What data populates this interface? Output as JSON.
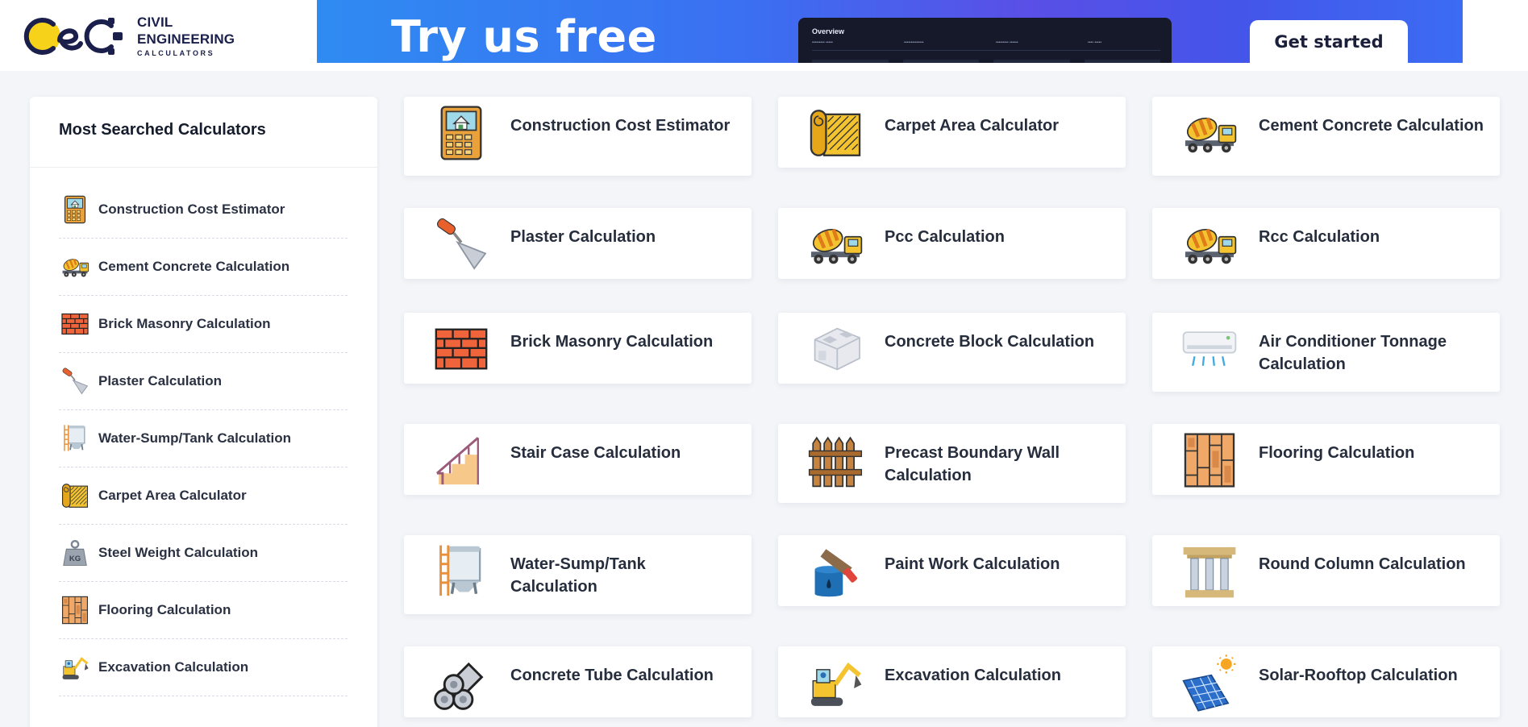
{
  "header": {
    "logo": {
      "line1": "CIVIL",
      "line2": "ENGINEERING",
      "line3": "CALCULATORS"
    },
    "banner": {
      "headline": "Try us free",
      "panel_title": "Overview",
      "panel_columns": [
        "••••••••• •••••",
        "••••••••••••••",
        "••••••••• ••••••",
        "•••• •••••"
      ],
      "cta_label": "Get started"
    }
  },
  "sidebar": {
    "title": "Most Searched Calculators",
    "items": [
      {
        "label": "Construction Cost Estimator",
        "icon": "calculator-house-icon"
      },
      {
        "label": "Cement Concrete Calculation",
        "icon": "concrete-mixer-truck-icon"
      },
      {
        "label": "Brick Masonry Calculation",
        "icon": "brick-wall-icon"
      },
      {
        "label": "Plaster Calculation",
        "icon": "plaster-trowel-icon"
      },
      {
        "label": "Water-Sump/Tank Calculation",
        "icon": "water-tank-icon"
      },
      {
        "label": "Carpet Area Calculator",
        "icon": "carpet-roll-icon"
      },
      {
        "label": "Steel Weight Calculation",
        "icon": "kg-weight-icon"
      },
      {
        "label": "Flooring Calculation",
        "icon": "wood-flooring-icon"
      },
      {
        "label": "Excavation Calculation",
        "icon": "excavator-icon"
      }
    ]
  },
  "cards": [
    {
      "label": "Construction Cost Estimator",
      "icon": "calculator-house-icon"
    },
    {
      "label": "Carpet Area Calculator",
      "icon": "carpet-roll-icon"
    },
    {
      "label": "Cement Concrete Calculation",
      "icon": "concrete-mixer-truck-icon"
    },
    {
      "label": "Plaster Calculation",
      "icon": "plaster-trowel-icon"
    },
    {
      "label": "Pcc Calculation",
      "icon": "concrete-mixer-truck-icon"
    },
    {
      "label": "Rcc Calculation",
      "icon": "concrete-mixer-truck-icon"
    },
    {
      "label": "Brick Masonry Calculation",
      "icon": "brick-wall-icon"
    },
    {
      "label": "Concrete Block Calculation",
      "icon": "concrete-block-icon"
    },
    {
      "label": "Air Conditioner Tonnage Calculation",
      "icon": "air-conditioner-icon"
    },
    {
      "label": "Stair Case Calculation",
      "icon": "staircase-icon"
    },
    {
      "label": "Precast Boundary Wall Calculation",
      "icon": "fence-icon"
    },
    {
      "label": "Flooring Calculation",
      "icon": "wood-flooring-icon"
    },
    {
      "label": "Water-Sump/Tank Calculation",
      "icon": "water-tank-icon"
    },
    {
      "label": "Paint Work Calculation",
      "icon": "paint-bucket-icon"
    },
    {
      "label": "Round Column Calculation",
      "icon": "column-icon"
    },
    {
      "label": "Concrete Tube Calculation",
      "icon": "concrete-pipes-icon"
    },
    {
      "label": "Excavation Calculation",
      "icon": "excavator-icon"
    },
    {
      "label": "Solar-Rooftop Calculation",
      "icon": "solar-panel-icon"
    }
  ],
  "colors": {
    "page_background": "#f3f5f9",
    "card_background": "#ffffff",
    "text_dark": "#262d3c",
    "logo_navy": "#1a1f4b",
    "logo_yellow": "#f6d21a",
    "banner_blue": "#3b6ff2",
    "banner_purple": "#5a4fe6"
  }
}
